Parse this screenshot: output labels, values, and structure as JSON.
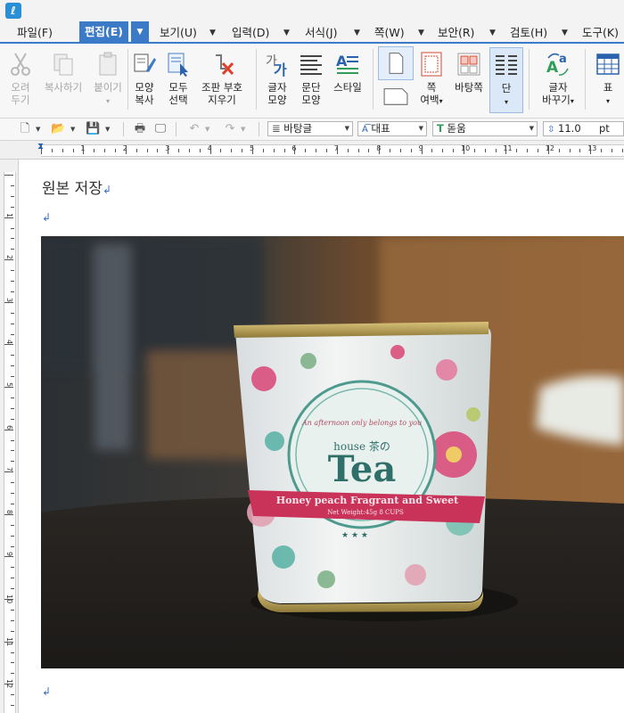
{
  "app": {
    "icon": "hwp-app-icon"
  },
  "menu": {
    "items": [
      {
        "label": "파일(F)"
      },
      {
        "label": "편집(E)"
      },
      {
        "label": "보기(U)"
      },
      {
        "label": "입력(D)"
      },
      {
        "label": "서식(J)"
      },
      {
        "label": "쪽(W)"
      },
      {
        "label": "보안(R)"
      },
      {
        "label": "검토(H)"
      },
      {
        "label": "도구(K)"
      }
    ]
  },
  "ribbon": {
    "cut": {
      "line1": "오려",
      "line2": "두기",
      "icon": "scissors-icon"
    },
    "copy": {
      "line1": "복사하기",
      "icon": "copy-icon"
    },
    "paste": {
      "line1": "붙이기",
      "icon": "paste-icon"
    },
    "format_copy": {
      "line1": "모양",
      "line2": "복사",
      "icon": "format-painter-icon"
    },
    "select_all": {
      "line1": "모두",
      "line2": "선택",
      "icon": "select-all-icon"
    },
    "erase_markup": {
      "line1": "조판 부호",
      "line2": "지우기",
      "icon": "erase-markup-icon"
    },
    "char_shape": {
      "line1": "글자",
      "line2": "모양",
      "icon": "char-shape-icon"
    },
    "para_shape": {
      "line1": "문단",
      "line2": "모양",
      "icon": "paragraph-icon"
    },
    "style": {
      "line1": "스타일",
      "icon": "style-icon"
    },
    "page_orient": {
      "icon": "page-icon"
    },
    "margin": {
      "line1": "쪽",
      "line2": "여백",
      "icon": "margin-icon"
    },
    "background": {
      "line1": "바탕쪽",
      "icon": "background-page-icon"
    },
    "columns": {
      "line1": "단",
      "icon": "columns-icon"
    },
    "replace": {
      "line1": "글자",
      "line2": "바꾸기",
      "icon": "replace-icon"
    },
    "table": {
      "line1": "표",
      "icon": "table-icon"
    }
  },
  "toolbar": {
    "style_value": "바탕글",
    "lang_value": "대표",
    "font_value": "돋움",
    "size_value": "11.0",
    "unit_value": "pt"
  },
  "ruler": {
    "h_numbers": [
      "1",
      "2",
      "3",
      "4",
      "5",
      "6",
      "7",
      "8",
      "9",
      "10",
      "11",
      "12",
      "13"
    ],
    "v_numbers": [
      "1",
      "2",
      "3",
      "4",
      "5",
      "6",
      "7",
      "8",
      "9",
      "10",
      "11",
      "12"
    ]
  },
  "document": {
    "title": "원본 저장",
    "para_mark": "↲",
    "image_text": {
      "small": "An afternoon only belongs to you",
      "house": "house 茶の",
      "brand": "Tea",
      "ribbon": "Honey peach Fragrant and Sweet",
      "weight": "Net Weight:45g  8 CUPS",
      "stars": "★ ★ ★"
    }
  },
  "colors": {
    "accent": "#3a7ac6",
    "para_mark": "#3a6fd0"
  }
}
